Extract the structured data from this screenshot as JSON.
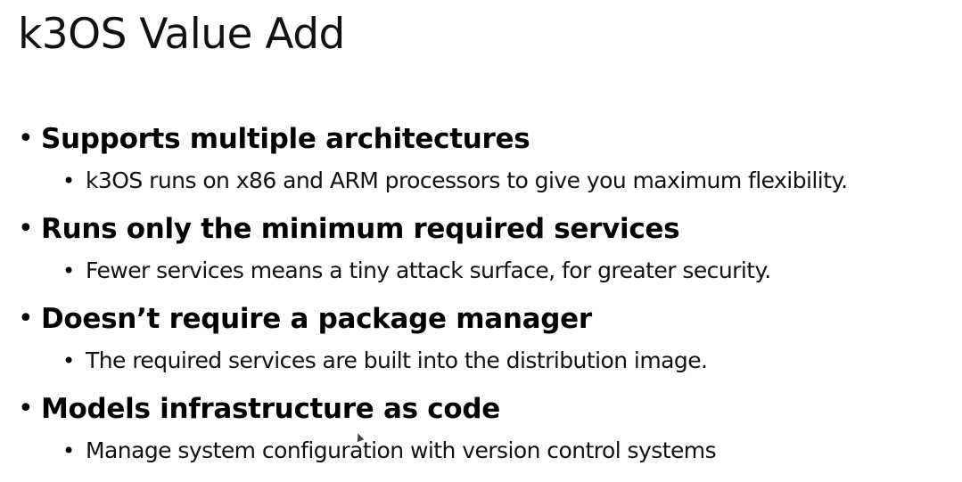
{
  "slide": {
    "title": "k3OS Value Add",
    "bullets": [
      {
        "text": "Supports multiple architectures",
        "sub": "k3OS runs on x86 and ARM processors to give you maximum flexibility."
      },
      {
        "text": "Runs only the minimum required services",
        "sub": "Fewer services means a tiny attack surface, for greater security."
      },
      {
        "text": "Doesn’t require a package manager",
        "sub": "The required services are built into the distribution image."
      },
      {
        "text": "Models infrastructure as code",
        "sub": "Manage system configuration with version control systems"
      }
    ],
    "bullet_glyph": "•"
  }
}
